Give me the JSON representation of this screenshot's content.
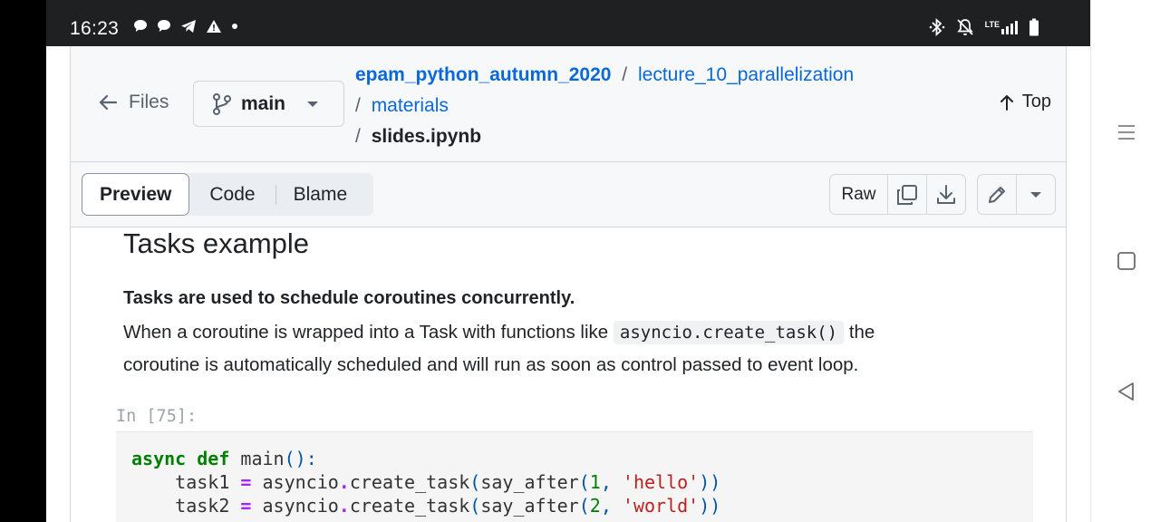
{
  "status_bar": {
    "time": "16:23",
    "notification_icons": [
      "chat-bubble-icon",
      "chat-bubble-icon",
      "telegram-icon",
      "warning-icon",
      "dot-icon"
    ],
    "system_icons": [
      "bluetooth-icon",
      "bell-off-icon",
      "lte-signal-icon",
      "battery-icon"
    ],
    "network_label": "LTE"
  },
  "header": {
    "files_label": "Files",
    "branch": "main",
    "breadcrumbs": {
      "repo": "epam_python_autumn_2020",
      "folder1": "lecture_10_parallelization",
      "folder2": "materials",
      "file": "slides.ipynb",
      "separator": "/"
    },
    "top_label": "Top"
  },
  "toolbar": {
    "tabs": [
      {
        "label": "Preview",
        "active": true
      },
      {
        "label": "Code",
        "active": false
      },
      {
        "label": "Blame",
        "active": false
      }
    ],
    "raw_label": "Raw"
  },
  "notebook": {
    "heading": "Tasks example",
    "lead": "Tasks are used to schedule coroutines concurrently.",
    "para_before_code": "When a coroutine is wrapped into a Task with functions like",
    "inline_code": "asyncio.create_task()",
    "para_after_code": "the",
    "para_line2": "coroutine is automatically scheduled and will run as soon as control passed to event loop.",
    "prompt": "In [75]:",
    "code_lines": [
      "async def main():",
      "    task1 = asyncio.create_task(say_after(1, 'hello'))",
      "    task2 = asyncio.create_task(say_after(2, 'world'))"
    ]
  },
  "colors": {
    "link": "#0969da",
    "keyword": "#008000",
    "string": "#ba2121",
    "operator": "#aa22ff",
    "status_bar_bg": "#1f2022"
  }
}
